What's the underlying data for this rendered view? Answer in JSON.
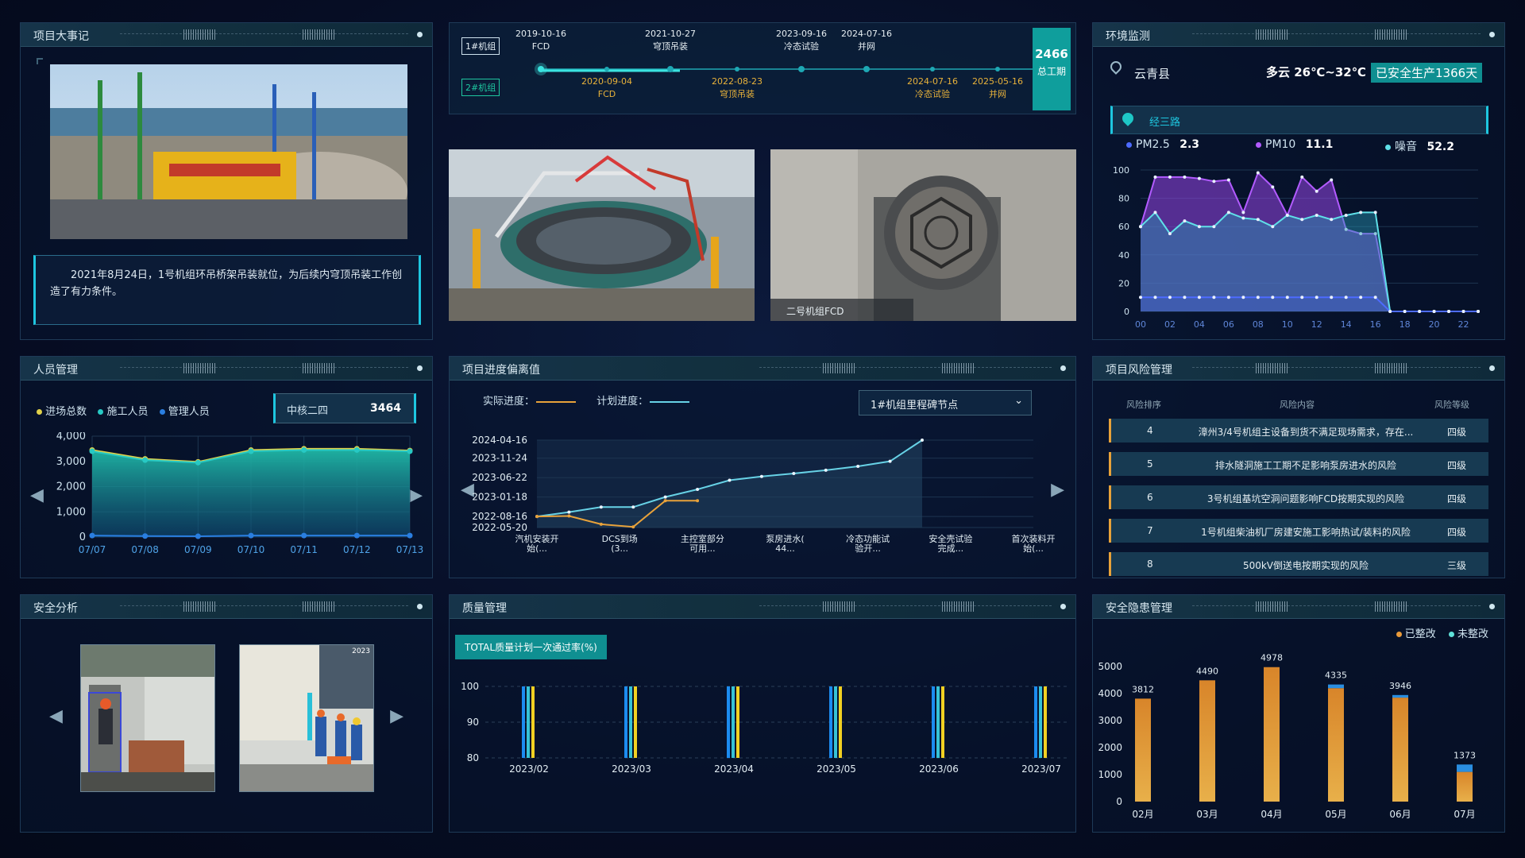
{
  "events": {
    "title": "项目大事记",
    "caption": "2021年8月24日，1号机组环吊桥架吊装就位，为后续内穹顶吊装工作创造了有力条件。"
  },
  "timeline": {
    "unit1_label": "1#机组",
    "unit2_label": "2#机组",
    "unit1": [
      {
        "date": "2019-10-16",
        "name": "FCD"
      },
      {
        "date": "2021-10-27",
        "name": "穹顶吊装"
      },
      {
        "date": "2023-09-16",
        "name": "冷态试验"
      },
      {
        "date": "2024-07-16",
        "name": "并网"
      }
    ],
    "unit2": [
      {
        "date": "2020-09-04",
        "name": "FCD"
      },
      {
        "date": "2022-08-23",
        "name": "穹顶吊装"
      },
      {
        "date": "2024-07-16",
        "name": "冷态试验"
      },
      {
        "date": "2025-05-16",
        "name": "并网"
      }
    ],
    "total_days": "2466",
    "total_label": "总工期"
  },
  "photos": {
    "right_caption": "二号机组FCD"
  },
  "env": {
    "title": "环境监测",
    "location": "云青县",
    "weather": "多云 26℃~32℃",
    "safe_days": "已安全生产1366天",
    "station": "经三路",
    "pm25_label": "PM2.5",
    "pm25": "2.3",
    "pm10_label": "PM10",
    "pm10": "11.1",
    "noise_label": "噪音",
    "noise": "52.2",
    "colors": {
      "pm25": "#4d6bff",
      "pm10": "#b25bff",
      "noise": "#5fe0e8"
    }
  },
  "personnel": {
    "title": "人员管理",
    "legend": [
      "进场总数",
      "施工人员",
      "管理人员"
    ],
    "company": "中核二四",
    "company_count": "3464"
  },
  "progress": {
    "title": "项目进度偏离值",
    "legend_actual": "实际进度：",
    "legend_plan": "计划进度：",
    "select": "1#机组里程碑节点"
  },
  "risk": {
    "title": "项目风险管理",
    "headers": [
      "风险排序",
      "风险内容",
      "风险等级"
    ],
    "rows": [
      {
        "n": "4",
        "text": "漳州3/4号机组主设备到货不满足现场需求，存在...",
        "level": "四级"
      },
      {
        "n": "5",
        "text": "排水隧洞施工工期不足影响泵房进水的风险",
        "level": "四级"
      },
      {
        "n": "6",
        "text": "3号机组基坑空洞问题影响FCD按期实现的风险",
        "level": "四级"
      },
      {
        "n": "7",
        "text": "1号机组柴油机厂房建安施工影响热试/装料的风险",
        "level": "四级"
      },
      {
        "n": "8",
        "text": "500kV倒送电按期实现的风险",
        "level": "三级"
      }
    ]
  },
  "safety": {
    "title": "安全分析",
    "cam_ts": "2023"
  },
  "quality": {
    "title": "质量管理",
    "button": "TOTAL质量计划一次通过率(%)"
  },
  "hazard": {
    "title": "安全隐患管理",
    "legend_done": "已整改",
    "legend_todo": "未整改"
  },
  "chart_data": [
    {
      "type": "area",
      "title": "",
      "x": [
        "00",
        "01",
        "02",
        "03",
        "04",
        "05",
        "06",
        "07",
        "08",
        "09",
        "10",
        "11",
        "12",
        "13",
        "14",
        "15",
        "16",
        "17",
        "18",
        "19",
        "20",
        "21",
        "22",
        "23"
      ],
      "xticks": [
        "00",
        "02",
        "04",
        "06",
        "08",
        "10",
        "12",
        "14",
        "16",
        "18",
        "20",
        "22"
      ],
      "ylim": [
        0,
        100
      ],
      "yticks": [
        0,
        20,
        40,
        60,
        80,
        100
      ],
      "series": [
        {
          "name": "PM10",
          "values": [
            60,
            95,
            95,
            95,
            94,
            92,
            93,
            70,
            98,
            88,
            68,
            95,
            85,
            93,
            58,
            55,
            55,
            0,
            0,
            0,
            0,
            0,
            0,
            0
          ]
        },
        {
          "name": "噪音",
          "values": [
            60,
            70,
            55,
            64,
            60,
            60,
            70,
            66,
            65,
            60,
            68,
            65,
            68,
            65,
            68,
            70,
            70,
            0,
            0,
            0,
            0,
            0,
            0,
            0
          ]
        },
        {
          "name": "PM2.5",
          "values": [
            10,
            10,
            10,
            10,
            10,
            10,
            10,
            10,
            10,
            10,
            10,
            10,
            10,
            10,
            10,
            10,
            10,
            0,
            0,
            0,
            0,
            0,
            0,
            0
          ]
        }
      ]
    },
    {
      "type": "area",
      "categories": [
        "07/07",
        "07/08",
        "07/09",
        "07/10",
        "07/11",
        "07/12",
        "07/13"
      ],
      "ylim": [
        0,
        4000
      ],
      "yticks": [
        "0",
        "1,000",
        "2,000",
        "3,000",
        "4,000"
      ],
      "series": [
        {
          "name": "进场总数",
          "values": [
            3450,
            3100,
            2980,
            3450,
            3500,
            3500,
            3430
          ]
        },
        {
          "name": "施工人员",
          "values": [
            3400,
            3050,
            2950,
            3400,
            3450,
            3450,
            3400
          ]
        },
        {
          "name": "管理人员",
          "values": [
            60,
            40,
            30,
            60,
            60,
            60,
            60
          ]
        }
      ]
    },
    {
      "type": "line",
      "categories": [
        "汽机安装开始(...",
        "DCS到场(3...",
        "主控室部分可用...",
        "泵房进水(44...",
        "冷态功能试验开...",
        "安全壳试验完成...",
        "首次装料开始(..."
      ],
      "yticks": [
        "2022-05-20",
        "2022-08-16",
        "2023-01-18",
        "2023-06-22",
        "2023-11-24",
        "2024-04-16"
      ],
      "series": [
        {
          "name": "计划进度",
          "values": [
            "2022-08-16",
            "2022-09-20",
            "2022-10-30",
            "2022-10-30",
            "2023-01-18",
            "2023-03-20",
            "2023-06-01",
            "2023-07-01",
            "2023-07-25",
            "2023-08-20",
            "2023-09-20",
            "2023-10-30",
            "2024-04-16"
          ]
        },
        {
          "name": "实际进度",
          "values": [
            "2022-08-16",
            "2022-08-20",
            "2022-06-15",
            "2022-05-25",
            "2022-12-20",
            "2022-12-20"
          ]
        }
      ]
    },
    {
      "type": "bar",
      "categories": [
        "2023/02",
        "2023/03",
        "2023/04",
        "2023/05",
        "2023/06",
        "2023/07"
      ],
      "ylim": [
        80,
        100
      ],
      "yticks": [
        80,
        90,
        100
      ],
      "series": [
        {
          "name": "",
          "values": [
            100,
            100,
            100,
            100,
            100,
            100
          ]
        },
        {
          "name": "",
          "values": [
            100,
            100,
            100,
            100,
            100,
            100
          ]
        },
        {
          "name": "",
          "values": [
            100,
            100,
            100,
            100,
            100,
            100
          ]
        }
      ],
      "colors": [
        "#1c8cf0",
        "#36c2d6",
        "#f2d021"
      ]
    },
    {
      "type": "bar",
      "categories": [
        "02月",
        "03月",
        "04月",
        "05月",
        "06月",
        "07月"
      ],
      "ylim": [
        0,
        5000
      ],
      "yticks": [
        0,
        1000,
        2000,
        3000,
        4000,
        5000
      ],
      "series": [
        {
          "name": "已整改",
          "values": [
            3812,
            4490,
            4978,
            4200,
            3850,
            1100
          ]
        },
        {
          "name": "未整改",
          "values": [
            0,
            0,
            0,
            135,
            96,
            273
          ]
        }
      ],
      "labels": [
        "3812",
        "4490",
        "4978",
        "4335",
        "3946",
        "1373"
      ]
    }
  ]
}
